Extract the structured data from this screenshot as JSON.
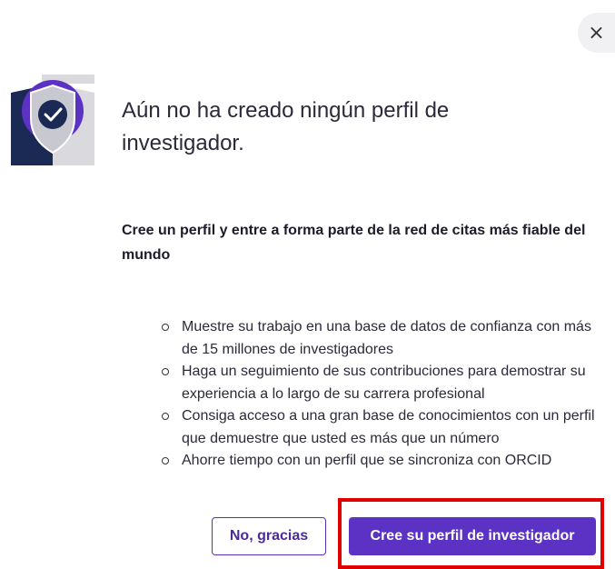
{
  "dialog": {
    "close_label": "×",
    "title": "Aún no ha creado ningún perfil de investigador.",
    "subtitle": "Cree un perfil y entre a forma parte de la red de citas más fiable del mundo",
    "benefits": [
      "Muestre su trabajo en una base de datos de confianza con más de 15 millones de investigadores",
      "Haga un seguimiento de sus contribuciones para demostrar su experiencia a lo largo de su carrera profesional",
      "Consiga acceso a una gran base de conocimientos con un perfil que demuestre que usted es más que un número",
      "Ahorre tiempo con un perfil que se sincroniza con ORCID"
    ],
    "decline_label": "No, gracias",
    "create_label": "Cree su perfil de investigador"
  },
  "icons": {
    "close": "close-icon",
    "shield": "shield-check-icon"
  },
  "colors": {
    "primary": "#5b32c4",
    "shield_dark": "#1b2a55",
    "shield_light": "#d9d9de",
    "highlight": "#e00000"
  }
}
